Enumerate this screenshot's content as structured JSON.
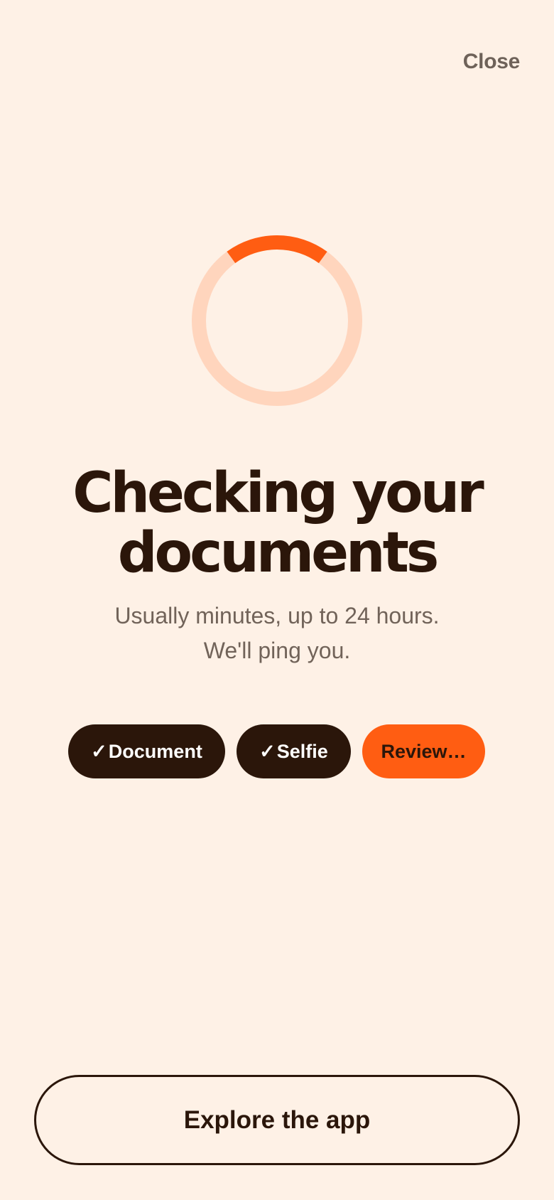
{
  "header": {
    "close_label": "Close"
  },
  "status": {
    "progress_fraction": 0.2,
    "track_color": "#FFD5BD",
    "arc_color": "#FF5D12"
  },
  "content": {
    "title_line1": "Checking your",
    "title_line2": "documents",
    "subtitle_line1": "Usually minutes, up to 24 hours.",
    "subtitle_line2": "We'll ping you."
  },
  "steps": [
    {
      "check": "✓",
      "label": "Document",
      "state": "done"
    },
    {
      "check": "✓",
      "label": "Selfie",
      "state": "done"
    },
    {
      "label": "Review…",
      "state": "in-progress"
    }
  ],
  "footer": {
    "explore_label": "Explore the app"
  },
  "colors": {
    "background": "#FEF1E6",
    "text_dark": "#2B160A",
    "text_muted": "#716359",
    "accent": "#FF5D12"
  }
}
